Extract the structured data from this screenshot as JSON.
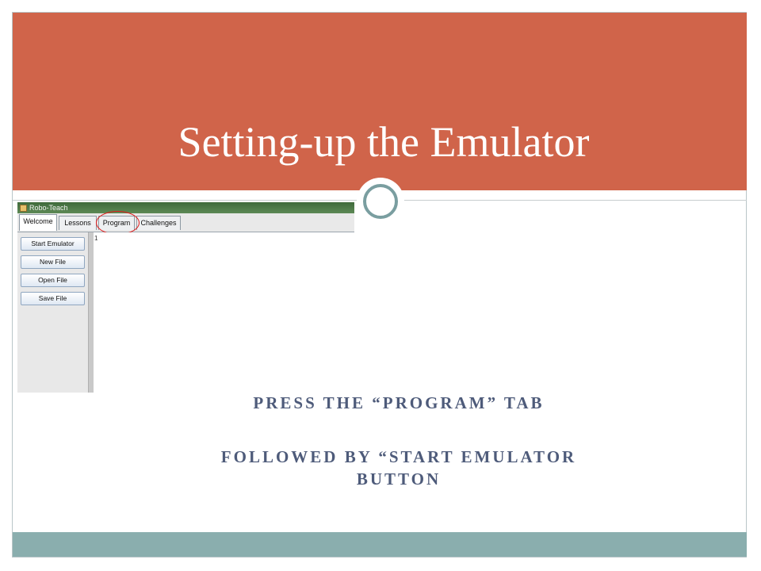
{
  "slide": {
    "title": "Setting-up the Emulator",
    "instructions": [
      "PRESS THE “PROGRAM” TAB",
      "FOLLOWED BY “START EMULATOR",
      "BUTTON"
    ]
  },
  "app": {
    "window_title": "Robo-Teach",
    "tabs": [
      "Welcome",
      "Lessons",
      "Program",
      "Challenges"
    ],
    "active_tab": "Welcome",
    "highlighted_tab": "Program",
    "side_buttons": [
      "Start Emulator",
      "New File",
      "Open File",
      "Save File"
    ],
    "editor_line_number": "1"
  },
  "colors": {
    "title_band": "#d0644a",
    "footer_band": "#8aaeae",
    "instruction_text": "#4e5b7a",
    "highlight_circle": "#e01a1a"
  }
}
